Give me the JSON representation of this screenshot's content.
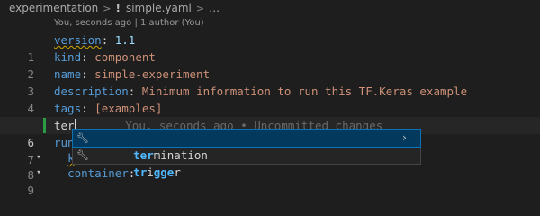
{
  "breadcrumb": {
    "folder": "experimentation",
    "file_icon": "!",
    "file": "simple.yaml",
    "more": "…"
  },
  "codelens": {
    "author_info": "You, seconds ago",
    "divider": "|",
    "authors": "1 author (You)"
  },
  "lines": [
    {
      "num": "1",
      "key": "version",
      "value": "1.1"
    },
    {
      "num": "2",
      "key": "kind",
      "value": "component"
    },
    {
      "num": "3",
      "key": "name",
      "value": "simple-experiment"
    },
    {
      "num": "4",
      "key": "description",
      "value": "Minimum information to run this TF.Keras example"
    },
    {
      "num": "5",
      "key": "tags",
      "value": "[examples]"
    },
    {
      "num": "6",
      "typed": "ter",
      "ghost": "You, seconds ago • Uncommitted changes"
    },
    {
      "num": "7",
      "fragment": "run"
    },
    {
      "num": "8",
      "fragment": "k"
    },
    {
      "num": "9",
      "key": "container"
    }
  ],
  "suggest": {
    "items": [
      {
        "match": "ter",
        "rest": "mination",
        "icon": "wrench-icon"
      },
      {
        "pre": "t",
        "m1": "r",
        "mid": "i",
        "m2": "gge",
        "post": "r",
        "icon": "wrench-icon"
      }
    ],
    "chevron_icon": "chevron-right-icon"
  },
  "colors": {
    "key": "#569cd6",
    "value": "#ce9178",
    "number": "#b5cea8",
    "match": "#4fb8ff",
    "selected_bg": "#04395e",
    "modified_bar": "#2a9d44"
  }
}
